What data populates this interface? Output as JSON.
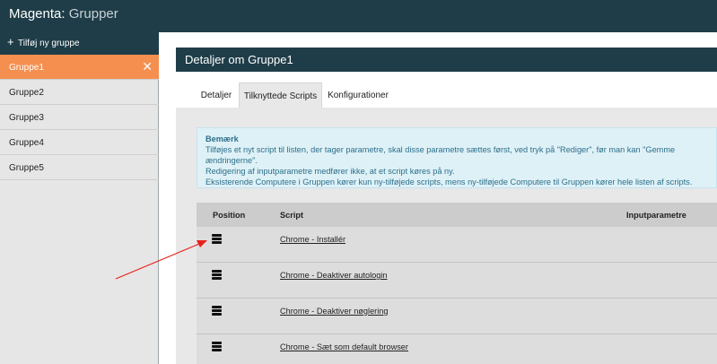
{
  "header": {
    "app_name": "Magenta:",
    "page_name": "Grupper"
  },
  "sidebar": {
    "add_label": "Tilføj ny gruppe",
    "groups": [
      {
        "label": "Gruppe1",
        "active": true
      },
      {
        "label": "Gruppe2"
      },
      {
        "label": "Gruppe3"
      },
      {
        "label": "Gruppe4"
      },
      {
        "label": "Gruppe5"
      }
    ]
  },
  "panel": {
    "title_prefix": "Detaljer om",
    "group_name": "Gruppe1"
  },
  "tabs": [
    {
      "label": "Detaljer"
    },
    {
      "label": "Tilknyttede Scripts",
      "active": true
    },
    {
      "label": "Konfigurationer"
    }
  ],
  "notice": {
    "heading": "Bemærk",
    "lines": [
      "Tilføjes et nyt script til listen, der tager parametre, skal disse parametre sættes først, ved tryk på \"Rediger\", før man kan \"Gemme ændringerne\".",
      "Redigering af inputparametre medfører ikke, at et script køres på ny.",
      "Eksisterende Computere i Gruppen kører kun ny-tilføjede scripts, mens ny-tilføjede Computere til Gruppen kører hele listen af scripts."
    ]
  },
  "table": {
    "headers": {
      "position": "Position",
      "script": "Script",
      "params": "Inputparametre"
    },
    "rows": [
      {
        "script": "Chrome - Installér"
      },
      {
        "script": "Chrome - Deaktiver autologin"
      },
      {
        "script": "Chrome - Deaktiver nøglering"
      },
      {
        "script": "Chrome - Sæt som default browser"
      }
    ]
  },
  "icons": {
    "drag_handle": "drag-handle-icon",
    "add": "plus-icon",
    "close": "close-icon"
  },
  "colors": {
    "topbar": "#1e3d48",
    "active_group": "#f58f4f",
    "notice_bg": "#def1f7",
    "annotation_arrow": "#e8201c"
  }
}
